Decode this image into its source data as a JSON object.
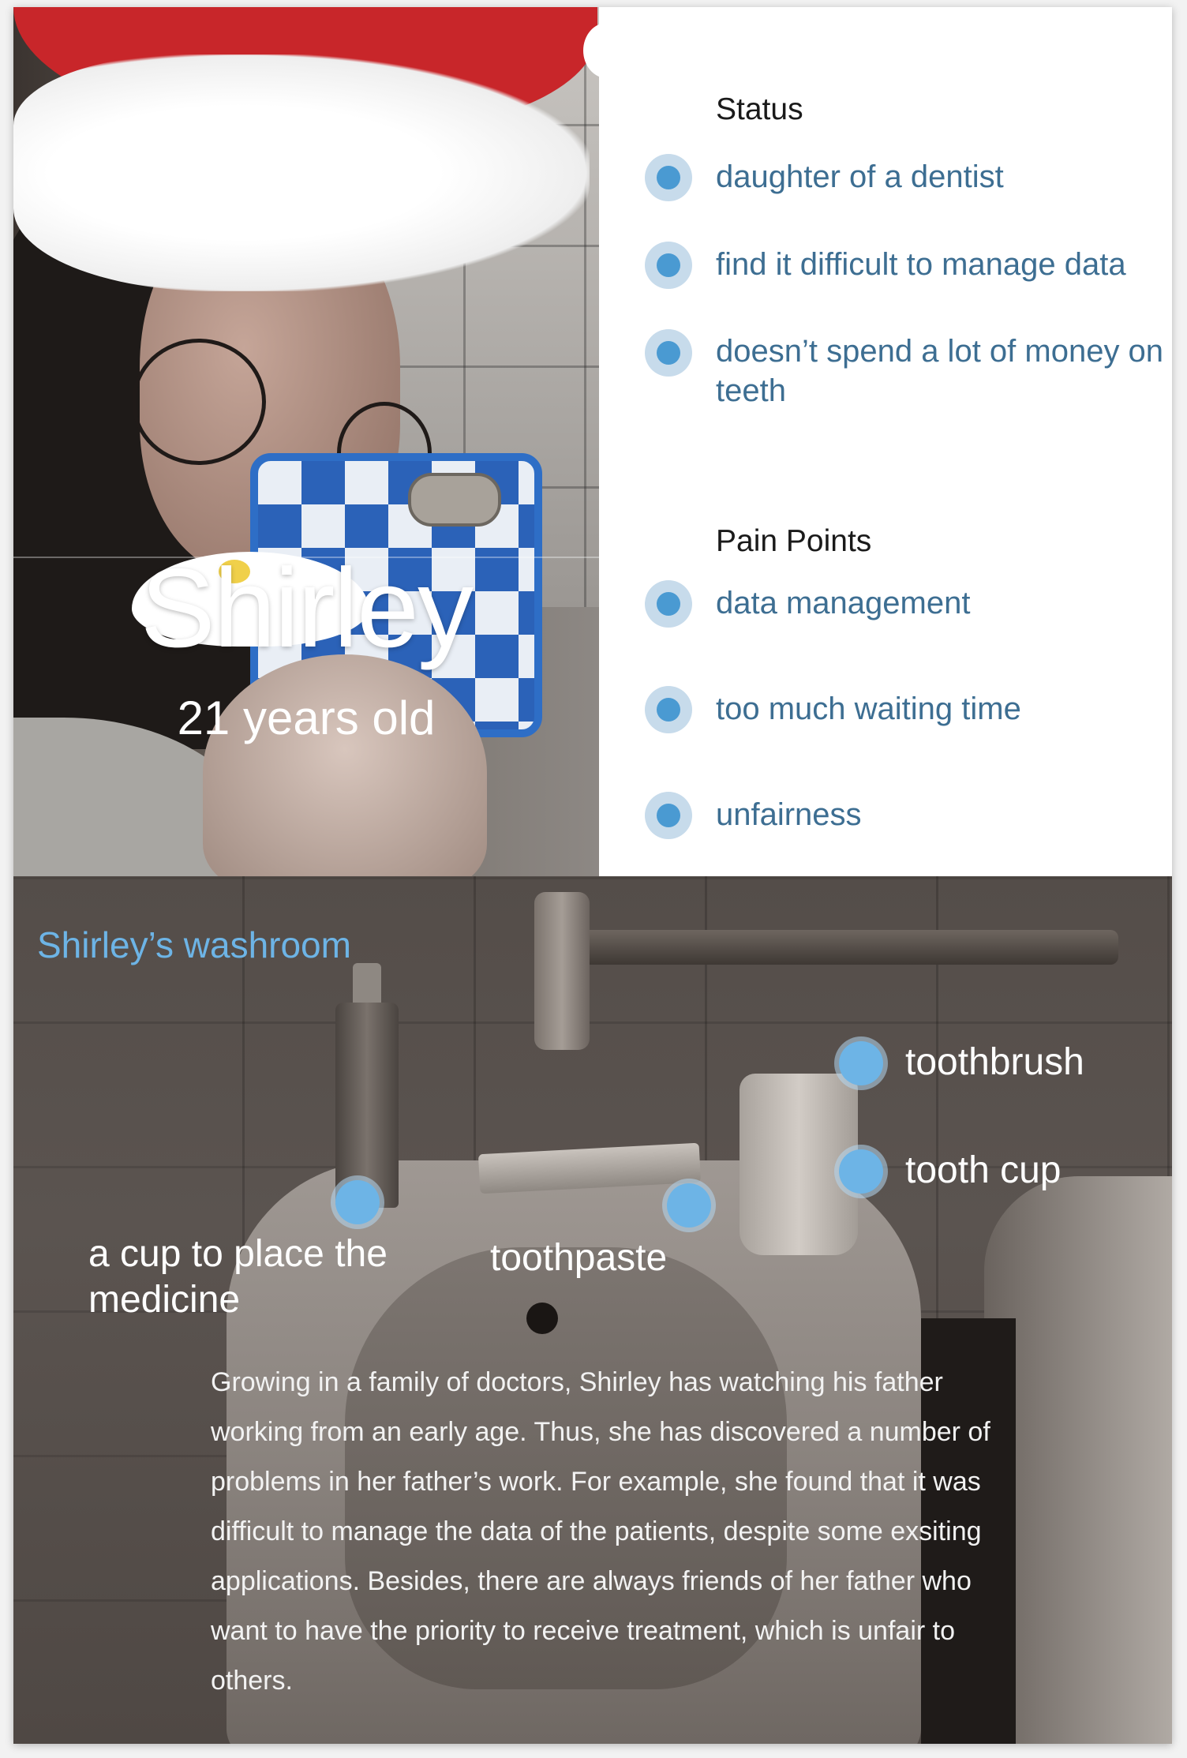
{
  "persona": {
    "name": "Shirley",
    "age": "21 years old"
  },
  "status": {
    "title": "Status",
    "items": [
      "daughter of a dentist",
      "find it difficult to manage data",
      "doesn’t spend a lot of money on teeth"
    ]
  },
  "pain_points": {
    "title": "Pain Points",
    "items": [
      "data management",
      "too much waiting time",
      "unfairness"
    ]
  },
  "washroom": {
    "title": "Shirley’s washroom",
    "hotspots": {
      "toothbrush": "toothbrush",
      "tooth_cup": "tooth cup",
      "medicine_cup": "a cup to place the medicine",
      "toothpaste": "toothpaste"
    },
    "story": "Growing in a family of doctors, Shirley has watching his father working from an early age. Thus, she has discovered a number of problems in her father’s work. For example, she found that it was difficult to manage the data of the patients, despite some exsiting applications. Besides, there are always friends of her father who want to have the priority to receive treatment, which is unfair to others."
  },
  "colors": {
    "accent_blue": "#6db4e6",
    "item_text": "#3d6e92",
    "bullet_ring": "#c7dbeb",
    "hat_red": "#c8262a"
  }
}
